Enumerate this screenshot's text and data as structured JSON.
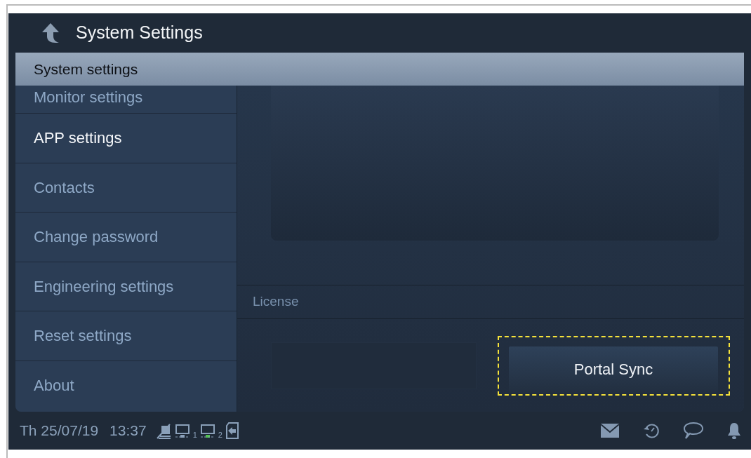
{
  "header": {
    "title": "System Settings"
  },
  "section_band": {
    "title": "System settings"
  },
  "sidebar": {
    "items": [
      {
        "label": "Monitor settings",
        "selected": false
      },
      {
        "label": "APP settings",
        "selected": true
      },
      {
        "label": "Contacts",
        "selected": false
      },
      {
        "label": "Change password",
        "selected": false
      },
      {
        "label": "Engineering settings",
        "selected": false
      },
      {
        "label": "Reset settings",
        "selected": false
      },
      {
        "label": "About",
        "selected": false
      }
    ]
  },
  "content": {
    "license_label": "License",
    "sync_button": {
      "label": "Portal Sync",
      "focused": true
    }
  },
  "status_bar": {
    "date": "Th 25/07/19",
    "time": "13:37",
    "indicators": [
      {
        "kind": "no-write"
      },
      {
        "kind": "monitor",
        "number": "1",
        "locked": false
      },
      {
        "kind": "monitor",
        "number": "2",
        "locked": true
      },
      {
        "kind": "card"
      }
    ],
    "actions": [
      {
        "kind": "mail"
      },
      {
        "kind": "history"
      },
      {
        "kind": "chat"
      },
      {
        "kind": "bell"
      }
    ]
  }
}
